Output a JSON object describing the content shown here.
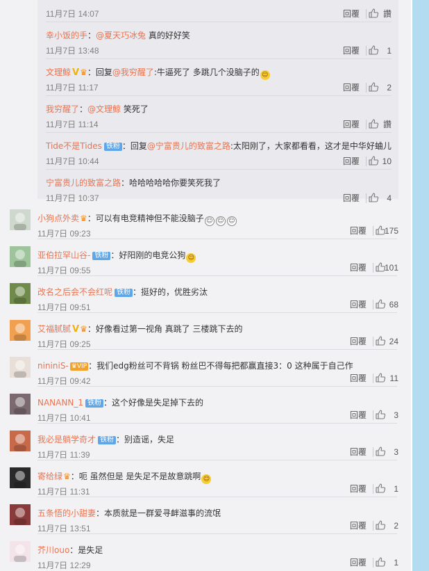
{
  "replies": [
    {
      "username": "",
      "badges": [],
      "text": "",
      "timestamp": "11月7日 14:07",
      "reply_label": "回覆",
      "likes": "讚"
    },
    {
      "username": "幸小饭的手",
      "badges": [],
      "text_parts": [
        {
          "t": "：",
          "k": "content"
        },
        {
          "t": "@夏天巧冰兔",
          "k": "mention"
        },
        {
          "t": " 真的好好笑",
          "k": "content"
        }
      ],
      "timestamp": "11月7日 13:48",
      "reply_label": "回覆",
      "likes": "1"
    },
    {
      "username": "文理鲸",
      "badges": [
        "v",
        "crown"
      ],
      "text_parts": [
        {
          "t": "：回复",
          "k": "content"
        },
        {
          "t": "@我穷醒了",
          "k": "mention"
        },
        {
          "t": ":牛逼死了 多跳几个没脑子的",
          "k": "content"
        },
        {
          "t": "emoji",
          "k": "emoji"
        }
      ],
      "timestamp": "11月7日 11:17",
      "reply_label": "回覆",
      "likes": "2"
    },
    {
      "username": "我穷醒了",
      "badges": [],
      "text_parts": [
        {
          "t": "：",
          "k": "content"
        },
        {
          "t": "@文理鲸",
          "k": "mention"
        },
        {
          "t": " 笑死了",
          "k": "content"
        }
      ],
      "timestamp": "11月7日 11:14",
      "reply_label": "回覆",
      "likes": "讚"
    },
    {
      "username": "Tide不是Tides",
      "badges": [
        "iron"
      ],
      "text_parts": [
        {
          "t": "：回复",
          "k": "content"
        },
        {
          "t": "@宁富贵儿的致富之路",
          "k": "mention"
        },
        {
          "t": ":太阳刚了，大家都看看，这才是中华好蛐儿",
          "k": "content"
        }
      ],
      "timestamp": "11月7日 10:44",
      "reply_label": "回覆",
      "likes": "10"
    },
    {
      "username": "宁富贵儿的致富之路",
      "badges": [],
      "text_parts": [
        {
          "t": "：哈哈哈哈哈你要笑死我了",
          "k": "content"
        }
      ],
      "timestamp": "11月7日 10:37",
      "reply_label": "回覆",
      "likes": "4"
    }
  ],
  "comments": [
    {
      "username": "小狗点外卖",
      "badges": [
        "crown"
      ],
      "text_parts": [
        {
          "t": "：可以有电竞精神但不能没脑子",
          "k": "content"
        },
        {
          "t": "ghost",
          "k": "emoji3"
        }
      ],
      "timestamp": "11月7日 09:23",
      "reply_label": "回覆",
      "likes": "175",
      "avatar": "#cfd8cc"
    },
    {
      "username": "亚伯拉罕山谷-",
      "badges": [
        "iron"
      ],
      "text_parts": [
        {
          "t": "：好阳刚的电竞公狗",
          "k": "content"
        },
        {
          "t": "emoji",
          "k": "emoji"
        }
      ],
      "timestamp": "11月7日 09:55",
      "reply_label": "回覆",
      "likes": "101",
      "avatar": "#9dc49a"
    },
    {
      "username": "改名之后会不会红呢",
      "badges": [
        "iron"
      ],
      "text_parts": [
        {
          "t": "：挺好的，优胜劣汰",
          "k": "content"
        }
      ],
      "timestamp": "11月7日 09:51",
      "reply_label": "回覆",
      "likes": "68",
      "avatar": "#6f8a4a"
    },
    {
      "username": "艾福腻腻",
      "badges": [
        "v",
        "crown"
      ],
      "text_parts": [
        {
          "t": "：好像看过第一视角 真跳了 三楼跳下去的",
          "k": "content"
        }
      ],
      "timestamp": "11月7日 09:25",
      "reply_label": "回覆",
      "likes": "24",
      "avatar": "#f0a050"
    },
    {
      "username": "nininiS-",
      "badges": [
        "vip"
      ],
      "text_parts": [
        {
          "t": "：我们edg粉丝可不背锅 粉丝巴不得每把都赢直接3：0 这种属于自己作",
          "k": "content"
        }
      ],
      "timestamp": "11月7日 09:42",
      "reply_label": "回覆",
      "likes": "11",
      "avatar": "#e8e0d8"
    },
    {
      "username": "NANANN_1",
      "badges": [
        "iron"
      ],
      "text_parts": [
        {
          "t": "：这个好像是失足掉下去的",
          "k": "content"
        }
      ],
      "timestamp": "11月7日 10:41",
      "reply_label": "回覆",
      "likes": "3",
      "avatar": "#7a6a70"
    },
    {
      "username": "我必是躺学奇才",
      "badges": [
        "iron"
      ],
      "text_parts": [
        {
          "t": "：别造谣，失足",
          "k": "content"
        }
      ],
      "timestamp": "11月7日 11:39",
      "reply_label": "回覆",
      "likes": "3",
      "avatar": "#c86a4a"
    },
    {
      "username": "寄给绿",
      "badges": [
        "crown"
      ],
      "text_parts": [
        {
          "t": "：呃 虽然但是 是失足不是故意跳啊",
          "k": "content"
        },
        {
          "t": "emoji",
          "k": "emoji"
        }
      ],
      "timestamp": "11月7日 11:31",
      "reply_label": "回覆",
      "likes": "1",
      "avatar": "#2a2a2a"
    },
    {
      "username": "五条悟的小甜妻",
      "badges": [],
      "text_parts": [
        {
          "t": "：本质就是一群爱寻衅滋事的流氓",
          "k": "content"
        }
      ],
      "timestamp": "11月7日 13:51",
      "reply_label": "回覆",
      "likes": "2",
      "avatar": "#8a3a3a"
    },
    {
      "username": "芥川ouo",
      "badges": [],
      "text_parts": [
        {
          "t": "：是失足",
          "k": "content"
        }
      ],
      "timestamp": "11月7日 12:29",
      "reply_label": "回覆",
      "likes": "1",
      "avatar": "#f2e4e8"
    }
  ]
}
